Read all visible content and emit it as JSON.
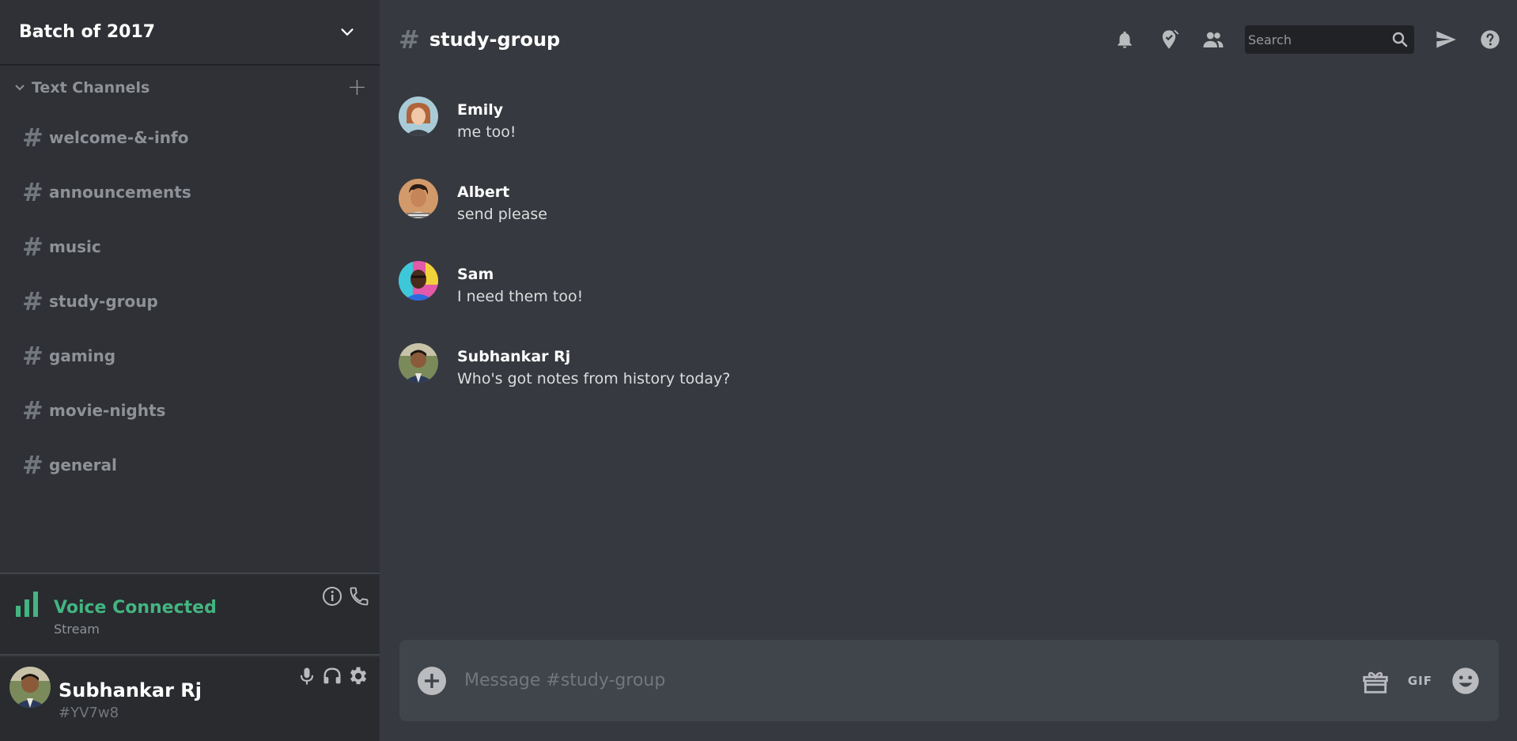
{
  "server": {
    "name": "Batch of 2017"
  },
  "category": {
    "label": "Text Channels"
  },
  "channels": [
    {
      "name": "welcome-&-info"
    },
    {
      "name": "announcements"
    },
    {
      "name": "music"
    },
    {
      "name": "study-group"
    },
    {
      "name": "gaming"
    },
    {
      "name": "movie-nights"
    },
    {
      "name": "general"
    }
  ],
  "voice": {
    "status": "Voice Connected",
    "sub": "Stream"
  },
  "user": {
    "name": "Subhankar Rj",
    "tag": "#YV7w8"
  },
  "current_channel": {
    "name": "study-group"
  },
  "search": {
    "placeholder": "Search"
  },
  "messages": [
    {
      "author": "Emily",
      "text": "me too!"
    },
    {
      "author": "Albert",
      "text": "send please"
    },
    {
      "author": "Sam",
      "text": "I need them too!"
    },
    {
      "author": "Subhankar Rj",
      "text": "Who's got notes from history today?"
    }
  ],
  "composer": {
    "placeholder": "Message #study-group",
    "gif_label": "GIF"
  },
  "colors": {
    "voice_green": "#43b581",
    "background": "#36393f",
    "sidebar": "#2f3136"
  }
}
